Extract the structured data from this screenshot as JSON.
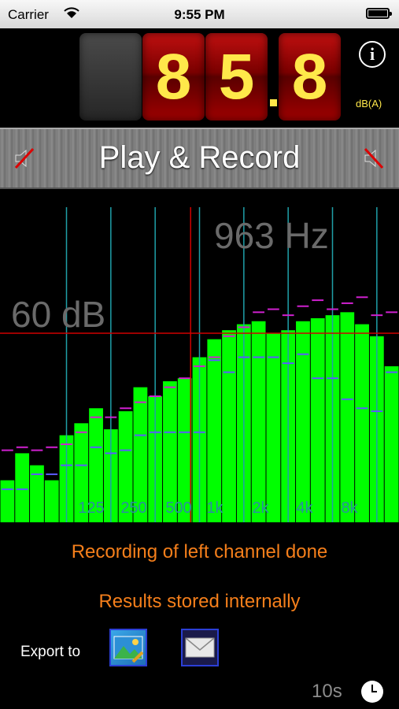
{
  "status_bar": {
    "carrier": "Carrier",
    "time": "9:55 PM"
  },
  "meter": {
    "digits": [
      "",
      "8",
      "5",
      "8"
    ],
    "unit": "dB(A)",
    "value": 85.8
  },
  "play_bar": {
    "title": "Play & Record"
  },
  "spectrum": {
    "frequency_readout": "963 Hz",
    "level_readout": "60 dB",
    "octave_labels": [
      "125",
      "250",
      "500",
      "1k",
      "2k",
      "4k",
      "8k"
    ],
    "bars_db": [
      14,
      23,
      19,
      14,
      29,
      33,
      38,
      31,
      37,
      45,
      42,
      47,
      48,
      55,
      61,
      64,
      66,
      67,
      63,
      64,
      67,
      68,
      69,
      70,
      66,
      62,
      52
    ],
    "leq_ticks_db": [
      11,
      11,
      16,
      16,
      19,
      19,
      25,
      23,
      24,
      29,
      30,
      30,
      30,
      30,
      54,
      50,
      55,
      55,
      55,
      53,
      56,
      48,
      48,
      41,
      38,
      37,
      50
    ],
    "max_ticks_db": [
      24,
      25,
      24,
      25,
      26,
      30,
      35,
      35,
      38,
      40,
      42,
      45,
      48,
      52,
      55,
      62,
      65,
      70,
      71,
      69,
      72,
      74,
      71,
      73,
      75,
      69,
      70
    ],
    "ref_line_db": 63,
    "db_range": [
      0,
      105
    ]
  },
  "messages": {
    "line1": "Recording of left channel done",
    "line2": "Results stored internally"
  },
  "export": {
    "label": "Export to",
    "photos_icon": "photos-icon",
    "mail_icon": "mail-icon"
  },
  "timer": {
    "label": "10s",
    "icon": "clock-icon"
  },
  "colors": {
    "bar": "#00ff00",
    "leq": "#5a5aff",
    "max": "#d020d0",
    "grid": "#1fa0a8",
    "ref": "#d00000",
    "message": "#f57f1b",
    "led": "#ffe84a"
  }
}
